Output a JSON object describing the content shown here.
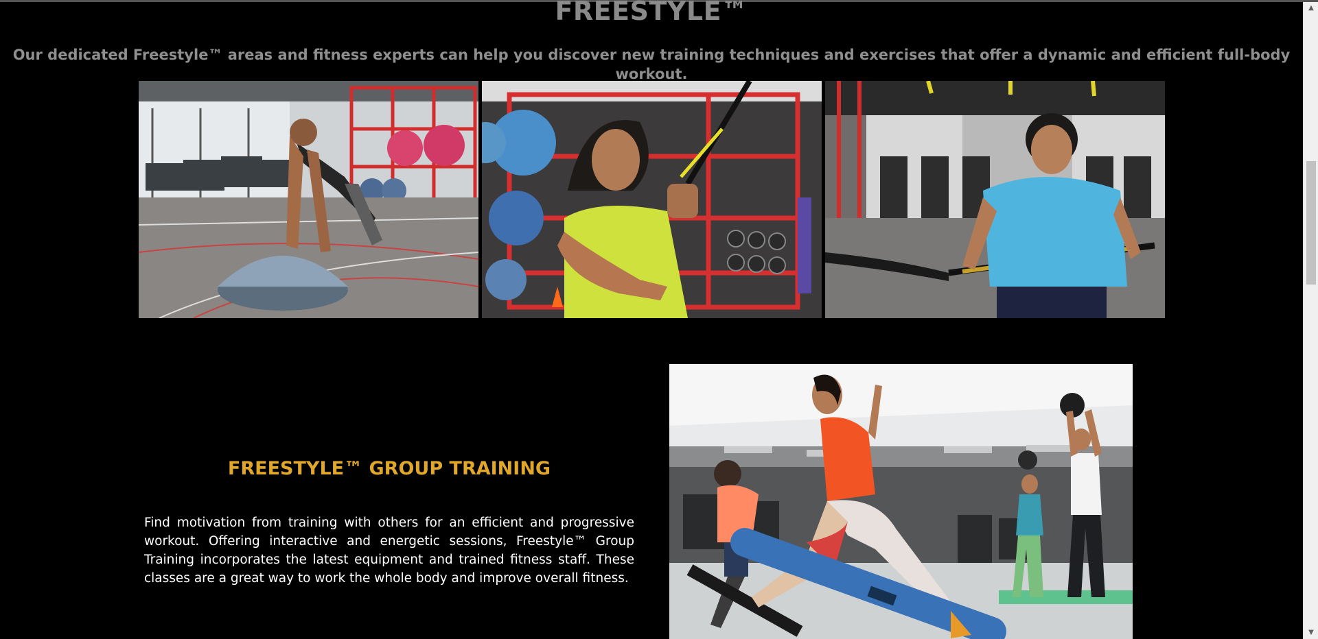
{
  "hero": {
    "title": "FREESTYLE™",
    "subtitle": "Our dedicated Freestyle™ areas and fitness experts can help you discover new training techniques and exercises that offer a dynamic and efficient full-body workout."
  },
  "gallery": {
    "images": [
      {
        "name": "bosu-pushup-photo"
      },
      {
        "name": "suspension-trainer-photo"
      },
      {
        "name": "battle-rope-photo"
      }
    ]
  },
  "group_training": {
    "title": "FREESTYLE™ GROUP TRAINING",
    "body": "Find motivation from training with others for an efficient and progressive workout. Offering interactive and energetic sessions, Freestyle™ Group Training incorporates the latest equipment and trained fitness staff. These classes are a great way to work the whole body and improve overall fitness."
  },
  "scrollbar": {
    "up_icon": "arrow-up-icon",
    "down_icon": "arrow-down-icon"
  },
  "colors": {
    "background": "#000000",
    "accent": "#e0a72a",
    "muted_text": "#8f8f8f",
    "body_text": "#ffffff"
  }
}
